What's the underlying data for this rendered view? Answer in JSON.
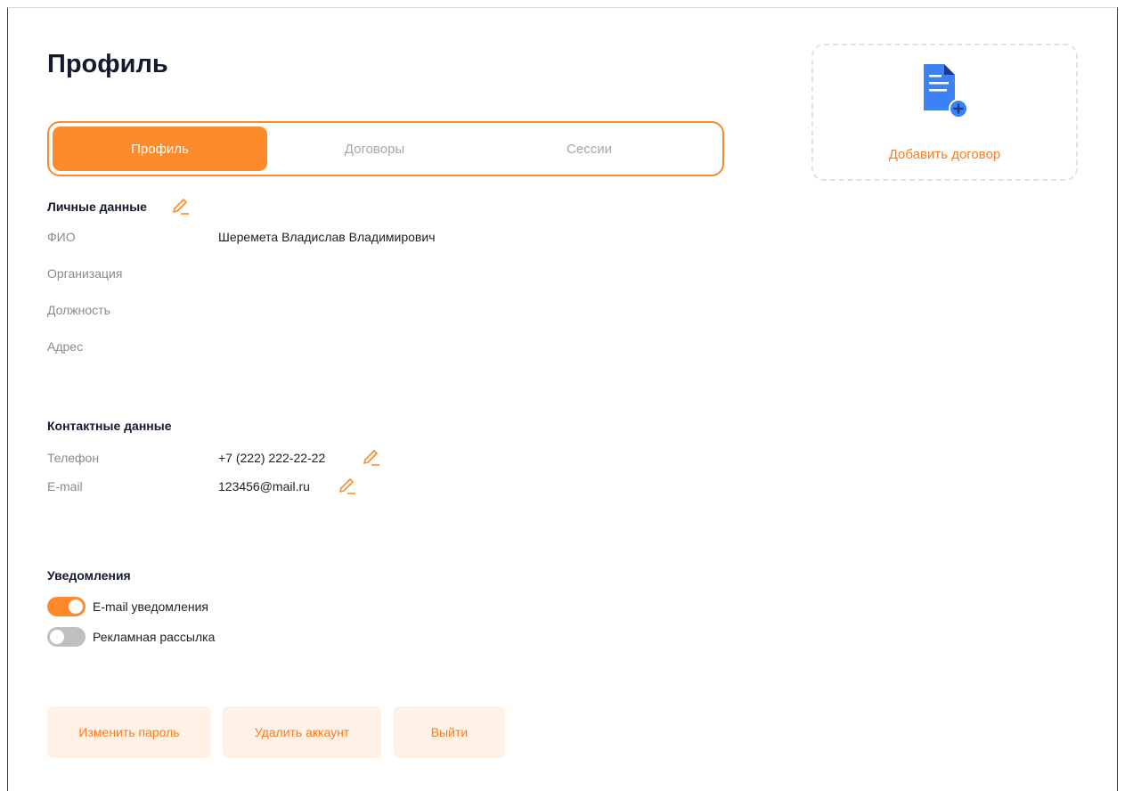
{
  "page": {
    "title": "Профиль"
  },
  "tabs": [
    {
      "label": "Профиль",
      "active": true
    },
    {
      "label": "Договоры",
      "active": false
    },
    {
      "label": "Сессии",
      "active": false
    }
  ],
  "add_contract": {
    "label": "Добавить договор",
    "icon": "document-add-icon"
  },
  "personal": {
    "title": "Личные данные",
    "fields": [
      {
        "label": "ФИО",
        "value": "Шеремета Владислав Владимирович"
      },
      {
        "label": "Организация",
        "value": ""
      },
      {
        "label": "Должность",
        "value": ""
      },
      {
        "label": "Адрес",
        "value": ""
      }
    ]
  },
  "contacts": {
    "title": "Контактные данные",
    "fields": [
      {
        "label": "Телефон",
        "value": "+7 (222) 222-22-22"
      },
      {
        "label": "E-mail",
        "value": "123456@mail.ru"
      }
    ]
  },
  "notifications": {
    "title": "Уведомления",
    "items": [
      {
        "label": "E-mail уведомления",
        "on": true
      },
      {
        "label": "Рекламная рассылка",
        "on": false
      }
    ]
  },
  "actions": {
    "change_password": "Изменить пароль",
    "delete_account": "Удалить аккаунт",
    "logout": "Выйти"
  },
  "colors": {
    "accent": "#ff8a2b",
    "accent_text": "#ff7a1a",
    "button_bg": "#fff1e6",
    "icon_blue": "#3b82f6",
    "icon_navy": "#1e3a8a"
  }
}
